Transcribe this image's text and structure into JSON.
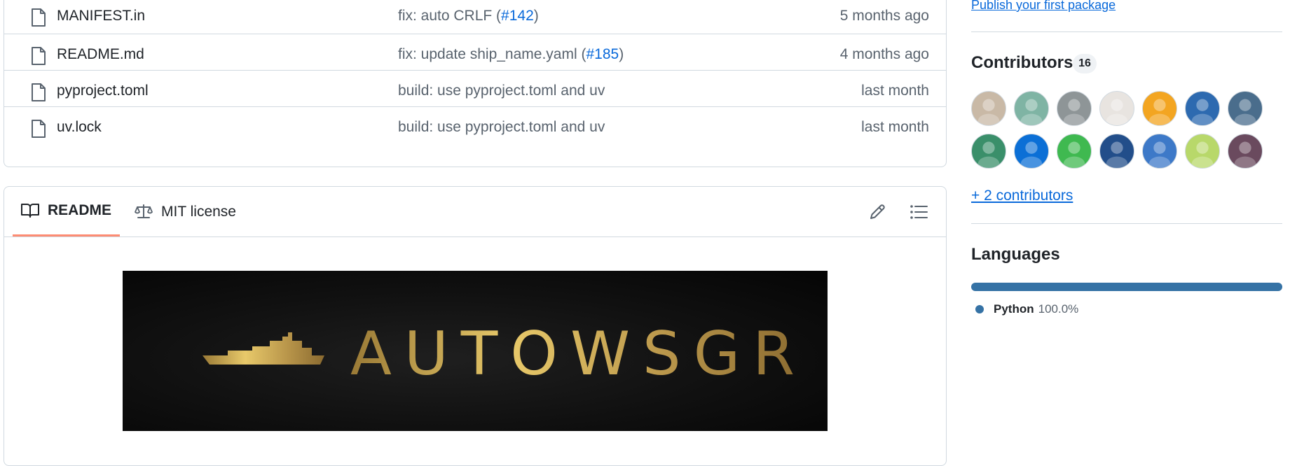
{
  "files": [
    {
      "name": "MANIFEST.in",
      "commit_text": "fix: auto CRLF (",
      "commit_link": "#142",
      "commit_suffix": ")",
      "time": "5 months ago"
    },
    {
      "name": "README.md",
      "commit_text": "fix: update ship_name.yaml (",
      "commit_link": "#185",
      "commit_suffix": ")",
      "time": "4 months ago"
    },
    {
      "name": "pyproject.toml",
      "commit_text": "build: use pyproject.toml and uv",
      "commit_link": "",
      "commit_suffix": "",
      "time": "last month"
    },
    {
      "name": "uv.lock",
      "commit_text": "build: use pyproject.toml and uv",
      "commit_link": "",
      "commit_suffix": "",
      "time": "last month"
    }
  ],
  "readme": {
    "tabs": [
      {
        "label": "README",
        "icon": "book-icon",
        "active": true
      },
      {
        "label": "MIT license",
        "icon": "law-icon",
        "active": false
      }
    ],
    "edit_icon": "pencil-icon",
    "toc_icon": "list-icon",
    "banner_text": "AUTOWSGR",
    "banner_colors": {
      "background": "#0b0b0b",
      "gold_light": "#e8c96a",
      "gold_dark": "#9a7a36"
    }
  },
  "sidebar": {
    "publish_link": "Publish your first package",
    "contributors": {
      "title": "Contributors",
      "count": "16",
      "avatars": [
        {
          "name": "avatar-cat-photo",
          "color": "#c9b9a6"
        },
        {
          "name": "avatar-ruler-sketch",
          "color": "#7fb4a4"
        },
        {
          "name": "avatar-statue",
          "color": "#8e9597"
        },
        {
          "name": "avatar-anime-white",
          "color": "#e8e4e0"
        },
        {
          "name": "avatar-p-sign",
          "color": "#f3a521"
        },
        {
          "name": "avatar-blue-cat",
          "color": "#2d6ab0"
        },
        {
          "name": "avatar-cat-sketch",
          "color": "#4a6d8c"
        },
        {
          "name": "avatar-robot-green",
          "color": "#3a8f6a"
        },
        {
          "name": "avatar-bot-blue",
          "color": "#0b6fd6"
        },
        {
          "name": "avatar-green-blocks",
          "color": "#3fb950"
        },
        {
          "name": "avatar-blue-emblem",
          "color": "#224e8a"
        },
        {
          "name": "avatar-blue-bird",
          "color": "#3d79c8"
        },
        {
          "name": "avatar-green-pixel",
          "color": "#b8d86a"
        },
        {
          "name": "avatar-anime-girl",
          "color": "#6a4a5e"
        }
      ],
      "more_link": "+ 2 contributors"
    },
    "languages": {
      "title": "Languages",
      "items": [
        {
          "name": "Python",
          "percent": "100.0%",
          "fraction": 1.0,
          "color": "#3572A5"
        }
      ]
    }
  }
}
